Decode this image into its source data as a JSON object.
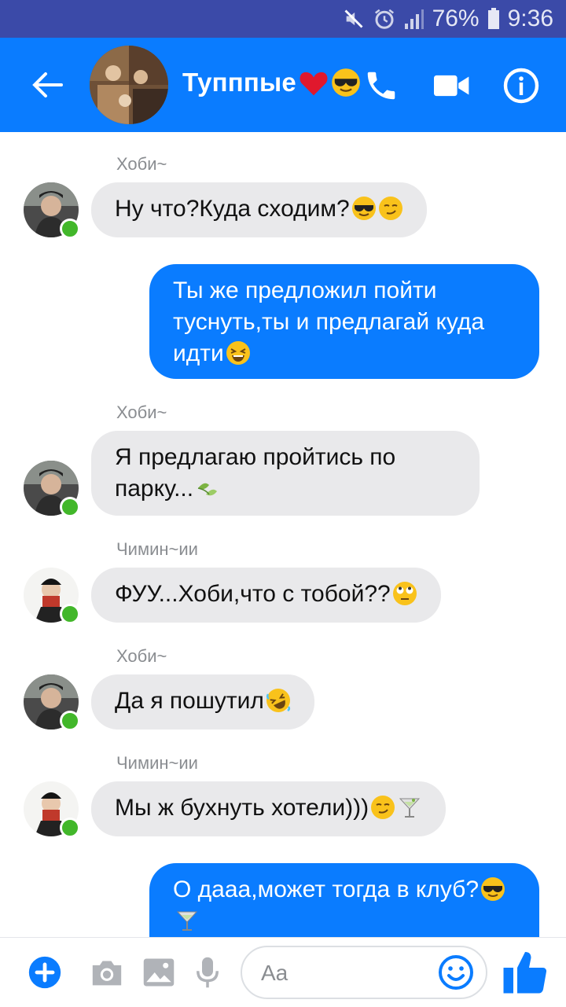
{
  "status_bar": {
    "battery": "76%",
    "time": "9:36"
  },
  "header": {
    "title": "Тупппые",
    "colors": {
      "bar": "#0a7cff"
    }
  },
  "messages": [
    {
      "sender": "Хоби~",
      "text": "Ну что?Куда сходим?"
    },
    {
      "text": "Ты же предложил пойти туснуть,ты и предлагай куда идти"
    },
    {
      "sender": "Хоби~",
      "text": "Я предлагаю пройтись по парку..."
    },
    {
      "sender": "Чимин~ии",
      "text": "ФУУ...Хоби,что с тобой??"
    },
    {
      "sender": "Хоби~",
      "text": "Да я пошутил"
    },
    {
      "sender": "Чимин~ии",
      "text": "Мы ж бухнуть хотели)))"
    },
    {
      "text": "О дааа,может тогда в клуб?"
    }
  ],
  "composer": {
    "placeholder": "Aa"
  }
}
